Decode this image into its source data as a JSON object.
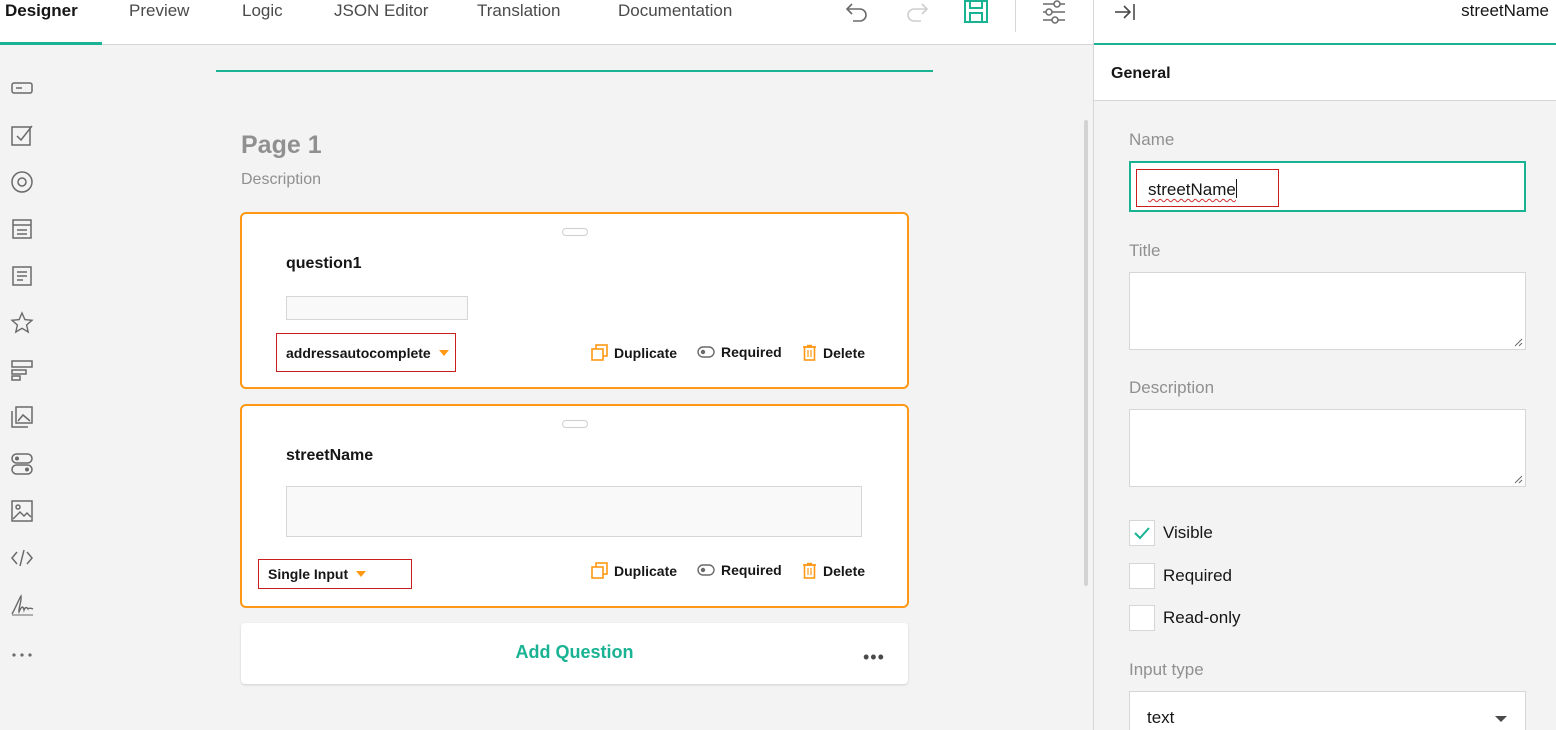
{
  "topbar": {
    "tabs": [
      {
        "label": "Designer"
      },
      {
        "label": "Preview"
      },
      {
        "label": "Logic"
      },
      {
        "label": "JSON Editor"
      },
      {
        "label": "Translation"
      },
      {
        "label": "Documentation"
      }
    ],
    "icons": [
      "undo-icon",
      "redo-icon",
      "save-icon",
      "settings-icon"
    ]
  },
  "toolbox": {
    "icons": [
      "single-input-icon",
      "checkbox-icon",
      "radiogroup-icon",
      "dropdown-icon",
      "comment-icon",
      "rating-icon",
      "ranking-icon",
      "image-picker-icon",
      "boolean-icon",
      "image-icon",
      "html-icon",
      "signature-pad-icon",
      "more-icon"
    ]
  },
  "canvas": {
    "page_title": "Page 1",
    "page_description": "Description",
    "questions": [
      {
        "title": "question1",
        "type": "addressautocomplete",
        "actions": {
          "duplicate": "Duplicate",
          "required": "Required",
          "delete": "Delete"
        }
      },
      {
        "title": "streetName",
        "type": "Single Input",
        "actions": {
          "duplicate": "Duplicate",
          "required": "Required",
          "delete": "Delete"
        }
      }
    ],
    "add_question": "Add Question",
    "more": "•••"
  },
  "panel": {
    "header_title": "streetName",
    "section": "General",
    "name_label": "Name",
    "name_value": "streetName",
    "title_label": "Title",
    "title_value": "",
    "description_label": "Description",
    "description_value": "",
    "checkboxes": [
      {
        "label": "Visible",
        "checked": true
      },
      {
        "label": "Required",
        "checked": false
      },
      {
        "label": "Read-only",
        "checked": false
      }
    ],
    "input_type_label": "Input type",
    "input_type_value": "text"
  },
  "colors": {
    "accent": "#19b394",
    "selection_orange": "#ff9814",
    "highlight_red": "#c81e1e"
  }
}
